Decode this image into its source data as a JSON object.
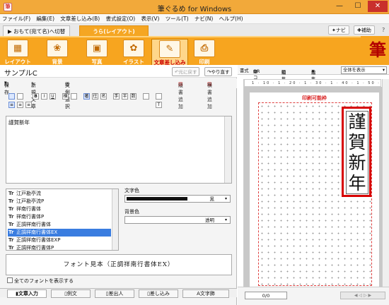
{
  "window": {
    "title": "筆ぐるめ for Windows",
    "controls": [
      "—",
      "☐",
      "✕"
    ]
  },
  "menu": [
    "ファイル(F)",
    "編集(E)",
    "文章差し込み(B)",
    "書式設定(O)",
    "表示(V)",
    "ツール(T)",
    "ナビ(N)",
    "ヘルプ(H)"
  ],
  "mode_tabs": {
    "switch_label": "▶ おもて(宛て名)へ切替",
    "active_label": "うら(レイアウト)"
  },
  "help_buttons": {
    "navi": "ナビ",
    "assist": "補助"
  },
  "ribbon": [
    {
      "label": "レイアウト",
      "icon": "layout-icon",
      "active": false
    },
    {
      "label": "背景",
      "icon": "background-icon",
      "active": false
    },
    {
      "label": "写真",
      "icon": "photo-icon",
      "active": false
    },
    {
      "label": "イラスト",
      "icon": "illustration-icon",
      "active": false
    },
    {
      "label": "文章差し込み",
      "icon": "text-insert-icon",
      "active": true
    },
    {
      "label": "印刷",
      "icon": "printer-icon",
      "active": false
    }
  ],
  "brand_char": "筆",
  "left_panel": {
    "title": "サンプルC",
    "undo_label": "元に戻す",
    "redo_label": "やり直す",
    "save_label": "保存",
    "new_text_label": "新規文章",
    "example_select_label": "文例選択",
    "vertical_add_label": "縦書追加",
    "horizontal_add_label": "横書追加",
    "text_content": "謹賀新年",
    "font_list": [
      {
        "name": "江戸勘亭流",
        "selected": false
      },
      {
        "name": "江戸勘亭流P",
        "selected": false
      },
      {
        "name": "祥南行書体",
        "selected": false
      },
      {
        "name": "祥南行書体P",
        "selected": false
      },
      {
        "name": "正調祥南行書体",
        "selected": false
      },
      {
        "name": "正調祥南行書体EX",
        "selected": true
      },
      {
        "name": "正調祥南行書体EXP",
        "selected": false
      },
      {
        "name": "正調祥南行書体P",
        "selected": false
      }
    ],
    "text_color_label": "文字色",
    "text_color_value": "黒",
    "bg_color_label": "背景色",
    "bg_color_value": "透明",
    "preview_text": "フォント見本（正調祥南行書体EX）",
    "show_all_fonts_label": "全てのフォントを表示する",
    "bottom_tabs": [
      {
        "label": "文章入力",
        "active": true
      },
      {
        "label": "例文",
        "active": false
      },
      {
        "label": "差出人",
        "active": false
      },
      {
        "label": "差し込み",
        "active": false
      },
      {
        "label": "文字飾",
        "active": false
      }
    ]
  },
  "right_panel": {
    "toolbar": [
      "書式",
      "QRコード",
      "編集設定",
      "編集削除"
    ],
    "display_select": "全体を表示",
    "printable_area_label": "印刷可能枠",
    "card_text": "謹賀新年",
    "page_indicator": "0/0"
  },
  "colors": {
    "accent": "#f7a51f",
    "title_bar": "#f2a93a",
    "frame_red": "#d70000",
    "selection_blue": "#3a7de0"
  }
}
